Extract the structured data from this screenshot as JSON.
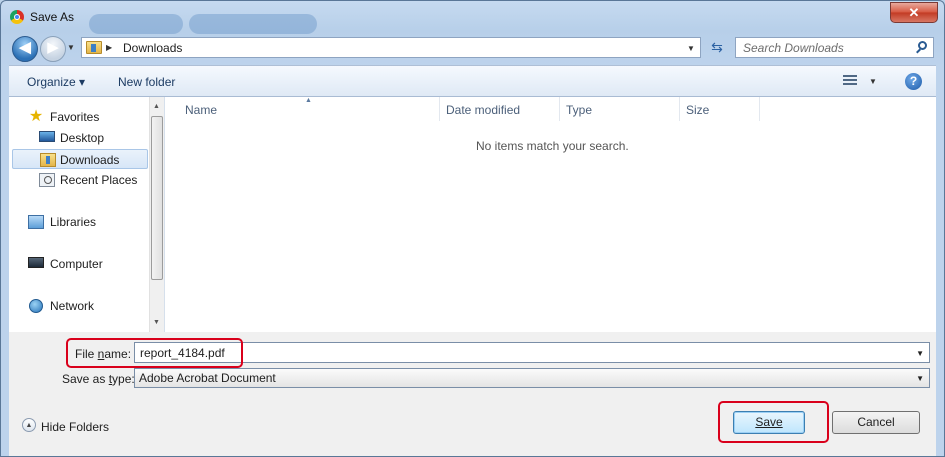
{
  "window": {
    "title": "Save As",
    "close_symbol": "✕"
  },
  "address": {
    "back_symbol": "◀",
    "forward_symbol": "▶",
    "location": "Downloads",
    "search_placeholder": "Search Downloads"
  },
  "toolbar": {
    "organize_label": "Organize ▾",
    "new_folder_label": "New folder",
    "help_symbol": "?"
  },
  "sidebar": {
    "items": [
      {
        "label": "Favorites",
        "icon": "star-icon"
      },
      {
        "label": "Desktop",
        "icon": "desktop-icon"
      },
      {
        "label": "Downloads",
        "icon": "downloads-folder-icon",
        "selected": true
      },
      {
        "label": "Recent Places",
        "icon": "recent-places-icon"
      },
      {
        "label": "Libraries",
        "icon": "libraries-icon"
      },
      {
        "label": "Computer",
        "icon": "computer-icon"
      },
      {
        "label": "Network",
        "icon": "network-icon"
      }
    ]
  },
  "filelist": {
    "columns": [
      "Name",
      "Date modified",
      "Type",
      "Size"
    ],
    "empty_message": "No items match your search."
  },
  "form": {
    "file_name_label_pre": "File ",
    "file_name_label_u": "n",
    "file_name_label_post": "ame:",
    "file_name_value": "report_4184.pdf",
    "save_type_label_pre": "Save as ",
    "save_type_label_u": "t",
    "save_type_label_post": "ype:",
    "save_type_value": "Adobe Acrobat Document"
  },
  "footer": {
    "hide_folders_label": "Hide Folders",
    "save_label": "Save",
    "cancel_label": "Cancel"
  },
  "colors": {
    "highlight": "#d9001b"
  }
}
